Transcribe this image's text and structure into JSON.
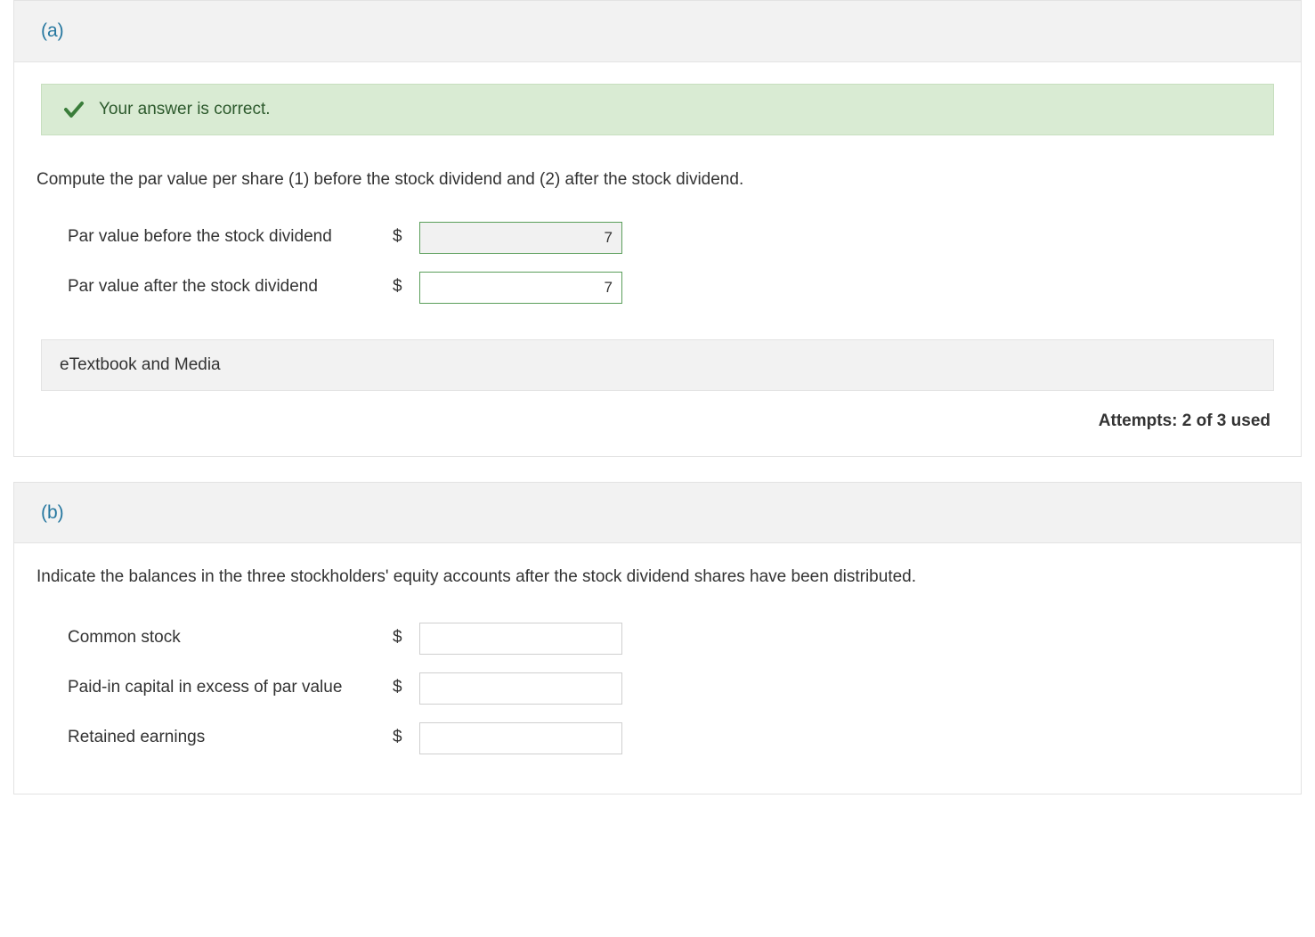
{
  "section_a": {
    "label": "(a)",
    "banner_text": "Your answer is correct.",
    "prompt": "Compute the par value per share (1) before the stock dividend and (2) after the stock dividend.",
    "rows": [
      {
        "label": "Par value before the stock dividend",
        "currency": "$",
        "value": "7"
      },
      {
        "label": "Par value after the stock dividend",
        "currency": "$",
        "value": "7"
      }
    ],
    "etextbook_label": "eTextbook and Media",
    "attempts_text": "Attempts: 2 of 3 used"
  },
  "section_b": {
    "label": "(b)",
    "prompt": "Indicate the balances in the three stockholders' equity accounts after the stock dividend shares have been distributed.",
    "rows": [
      {
        "label": "Common stock",
        "currency": "$",
        "value": ""
      },
      {
        "label": "Paid-in capital in excess of par value",
        "currency": "$",
        "value": ""
      },
      {
        "label": "Retained earnings",
        "currency": "$",
        "value": ""
      }
    ]
  }
}
